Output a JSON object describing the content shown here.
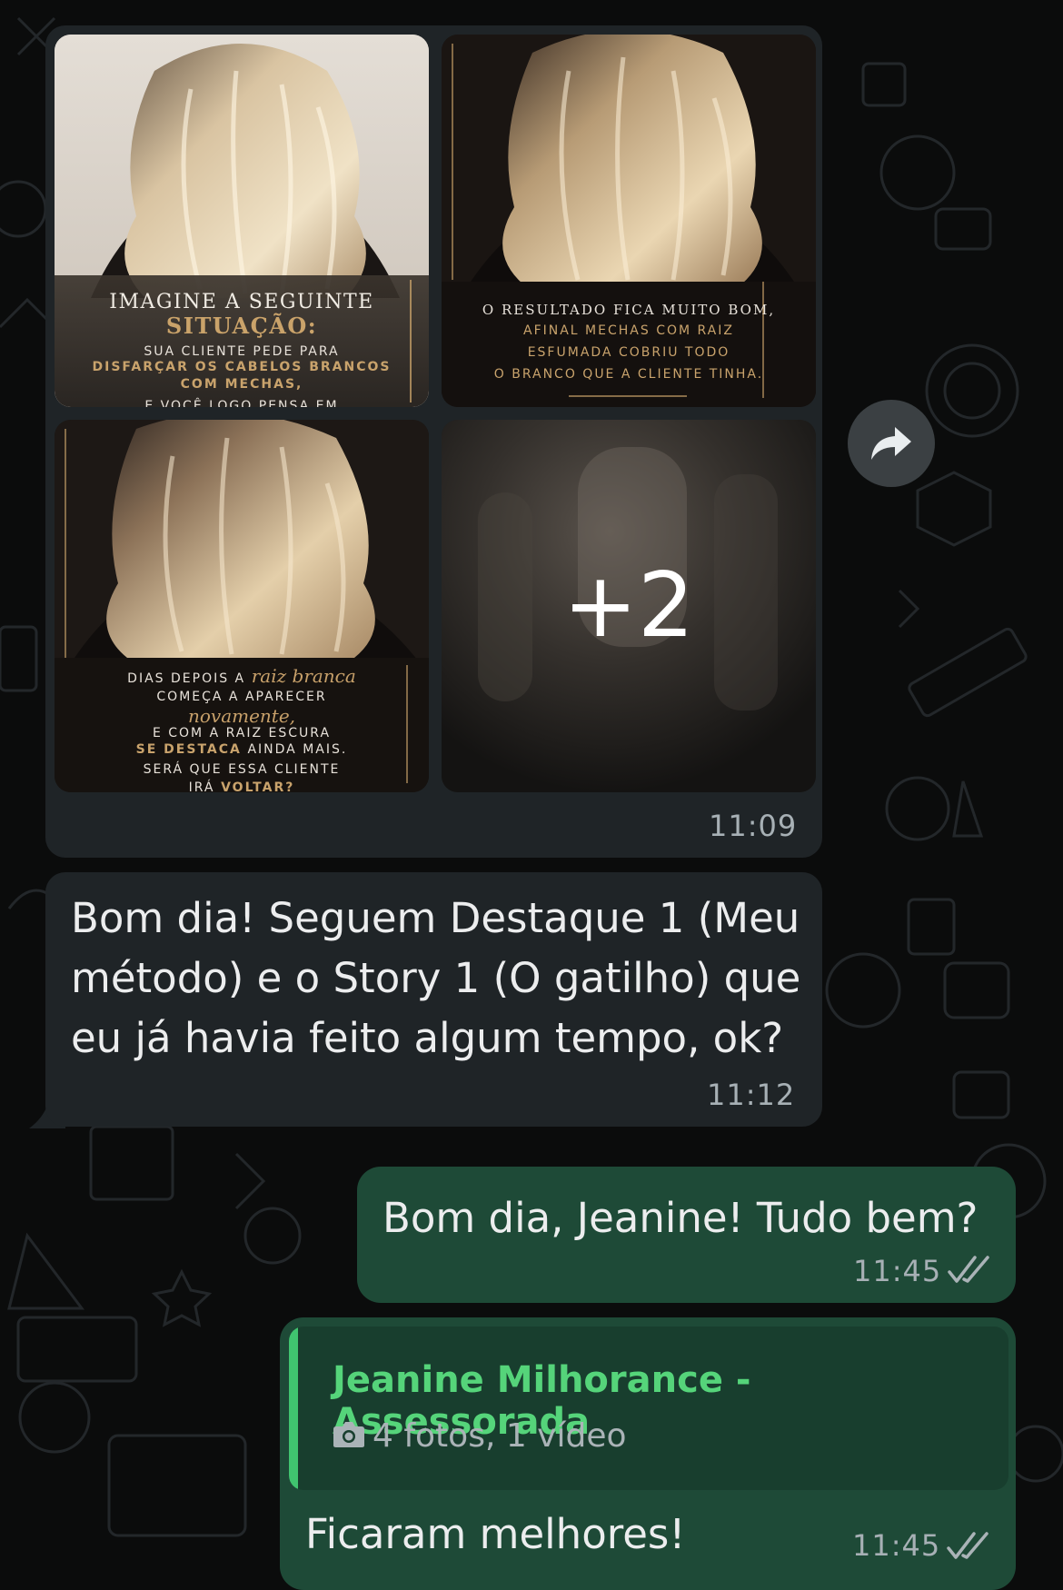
{
  "chat": {
    "album": {
      "photo1": {
        "line1": "IMAGINE A SEGUINTE",
        "line2": "SITUAÇÃO:",
        "line3": "SUA CLIENTE PEDE PARA",
        "line4": "DISFARÇAR OS CABELOS BRANCOS",
        "line5": "COM MECHAS,",
        "line6": "E VOCÊ LOGO PENSA EM"
      },
      "photo2": {
        "line1": "O RESULTADO FICA MUITO BOM,",
        "line2": "AFINAL MECHAS COM RAIZ",
        "line3": "ESFUMADA COBRIU TODO",
        "line4": "O BRANCO QUE A CLIENTE TINHA."
      },
      "photo3": {
        "line1a": "DIAS DEPOIS A",
        "line1b": "raiz branca",
        "line2": "COMEÇA A APARECER",
        "line3": "novamente,",
        "line4": "E COM A RAIZ ESCURA",
        "line5a": "SE DESTACA",
        "line5b": "AINDA MAIS.",
        "line6": "SERÁ QUE ESSA CLIENTE",
        "line7a": "IRÁ",
        "line7b": "VOLTAR?"
      },
      "more_count": "+2",
      "time": "11:09"
    },
    "incoming_text": {
      "line1": "Bom dia! Seguem Destaque 1 (Meu",
      "line2": "método) e o Story 1 (O gatilho) que",
      "line3": "eu já havia feito algum tempo, ok?",
      "time": "11:12"
    },
    "outgoing1": {
      "text": "Bom dia, Jeanine! Tudo bem?",
      "time": "11:45"
    },
    "outgoing2": {
      "quote_author": "Jeanine Milhorance - Assessorada",
      "quote_desc": "4 fotos, 1 vídeo",
      "text": "Ficaram melhores!",
      "time": "11:45"
    }
  },
  "colors": {
    "background": "#0b0c0c",
    "incoming_bubble": "#1f2427",
    "outgoing_bubble": "#1e4a37",
    "quote_accent": "#40c46f",
    "read_ticks": "#aab3b7"
  },
  "icons": {
    "forward": "forward-icon",
    "camera": "camera-icon",
    "read_receipt": "double-check-icon"
  }
}
